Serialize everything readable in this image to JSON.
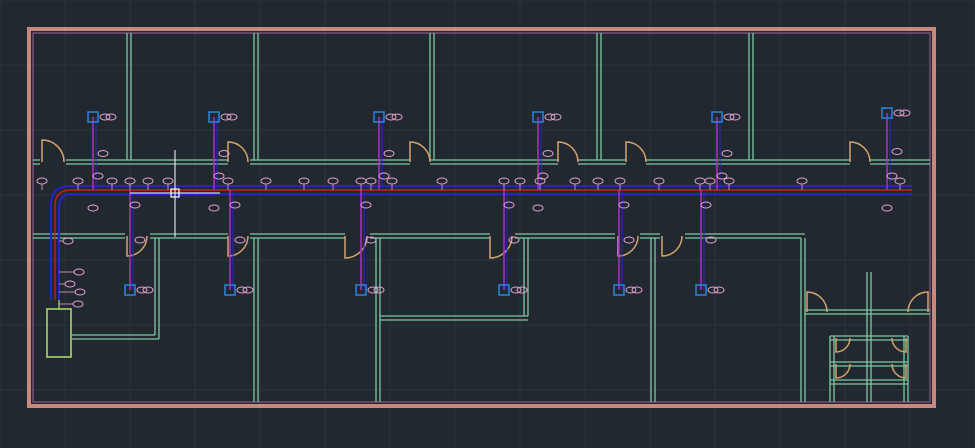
{
  "viewport": {
    "background": "#212830",
    "grid_color": "#2b333b"
  },
  "colors": {
    "outer_wall": "#c9887e",
    "outer_wall_inner": "#8a5a86",
    "wall": "#7cc8a3",
    "door_swing": "#d6a36c",
    "duct_outer": "#2424c8",
    "duct_inner": "#c02020",
    "branch": "#a030c0",
    "tag": "#e8a0d0",
    "diffuser": "#2a7fd4",
    "crosshair": "#ffffff",
    "equipment": "#b0e070"
  },
  "icons": {
    "crosshair": "crosshair-cursor-icon",
    "diffuser": "supply-diffuser-icon",
    "tag": "callout-tag-icon",
    "door": "door-swing-icon"
  }
}
